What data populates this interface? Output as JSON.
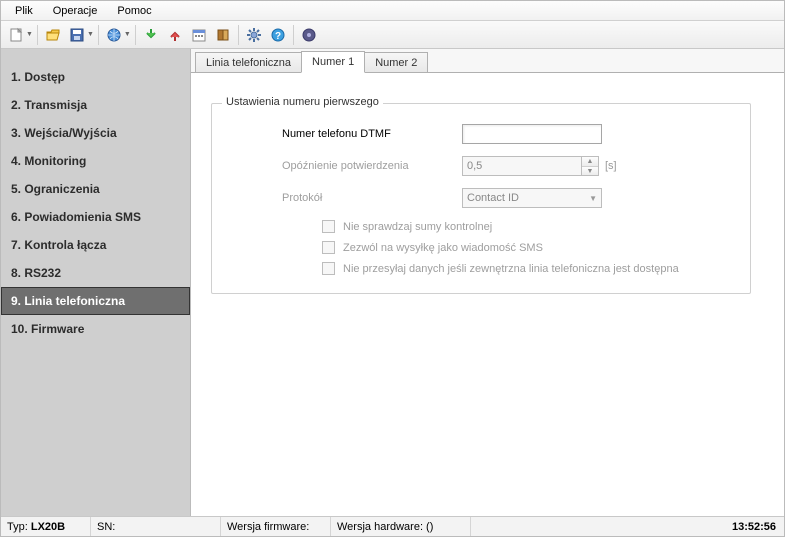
{
  "menubar": {
    "items": [
      "Plik",
      "Operacje",
      "Pomoc"
    ]
  },
  "toolbar": {
    "icons": [
      "new",
      "open",
      "save",
      "globe",
      "download",
      "upload",
      "calendar",
      "book",
      "gear",
      "help",
      "net"
    ]
  },
  "sidebar": {
    "items": [
      {
        "label": "1. Dostęp"
      },
      {
        "label": "2. Transmisja"
      },
      {
        "label": "3. Wejścia/Wyjścia"
      },
      {
        "label": "4. Monitoring"
      },
      {
        "label": "5. Ograniczenia"
      },
      {
        "label": "6. Powiadomienia SMS"
      },
      {
        "label": "7. Kontrola łącza"
      },
      {
        "label": "8. RS232"
      },
      {
        "label": "9. Linia telefoniczna"
      },
      {
        "label": "10. Firmware"
      }
    ],
    "active_index": 8
  },
  "tabs": {
    "items": [
      "Linia telefoniczna",
      "Numer 1",
      "Numer 2"
    ],
    "active_index": 1
  },
  "group": {
    "legend": "Ustawienia numeru pierwszego",
    "phone_label": "Numer telefonu DTMF",
    "phone_value": "",
    "delay_label": "Opóźnienie potwierdzenia",
    "delay_value": "0,5",
    "delay_unit": "[s]",
    "protocol_label": "Protokół",
    "protocol_value": "Contact ID",
    "chk1": "Nie sprawdzaj sumy kontrolnej",
    "chk2": "Zezwól na wysyłkę jako wiadomość SMS",
    "chk3": "Nie przesyłaj danych jeśli zewnętrzna linia telefoniczna jest dostępna"
  },
  "status": {
    "type_label": "Typ:",
    "type_value": "LX20B",
    "sn_label": "SN:",
    "sn_value": "",
    "fw_label": "Wersja firmware:",
    "fw_value": "",
    "hw_label": "Wersja hardware: ()",
    "clock": "13:52:56"
  }
}
